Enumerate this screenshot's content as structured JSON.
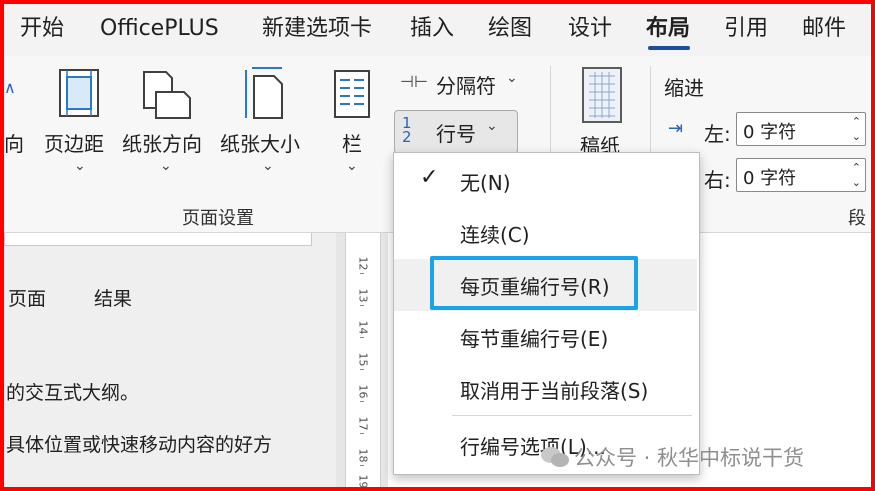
{
  "tabs": [
    {
      "label": "开始"
    },
    {
      "label": "OfficePLUS"
    },
    {
      "label": "新建选项卡"
    },
    {
      "label": "插入"
    },
    {
      "label": "绘图"
    },
    {
      "label": "设计"
    },
    {
      "label": "布局",
      "active": true
    },
    {
      "label": "引用"
    },
    {
      "label": "邮件"
    }
  ],
  "ribbon": {
    "orientation_partial": "向",
    "margins": "页边距",
    "paper_orientation": "纸张方向",
    "paper_size": "纸张大小",
    "columns": "栏",
    "breaks": "分隔符",
    "line_numbers": "行号",
    "manuscript": "稿纸",
    "page_setup_group": "页面设置",
    "indent_title": "缩进",
    "indent_left_label": "左:",
    "indent_right_label": "右:",
    "indent_left_value": "0 字符",
    "indent_right_value": "0 字符",
    "paragraph_group_partial": "段"
  },
  "menu": {
    "items": [
      {
        "label": "无(N)",
        "checked": true
      },
      {
        "label": "连续(C)"
      },
      {
        "label": "每页重编行号(R)",
        "highlighted": true
      },
      {
        "label": "每节重编行号(E)"
      },
      {
        "label": "取消用于当前段落(S)"
      },
      {
        "label": "行编号选项(L)..."
      }
    ]
  },
  "nav": {
    "tab_pages": "页面",
    "tab_results": "结果",
    "line1": "的交互式大纲。",
    "line2": "具体位置或快速移动内容的好方"
  },
  "ruler_numbers": [
    "12",
    "13",
    "14",
    "15",
    "16",
    "17",
    "18",
    "19"
  ],
  "watermark": "公众号 · 秋华中标说干货",
  "colors": {
    "frame": "#ff0000",
    "focus": "#1aa3e8",
    "accent": "#1f4e9c"
  }
}
